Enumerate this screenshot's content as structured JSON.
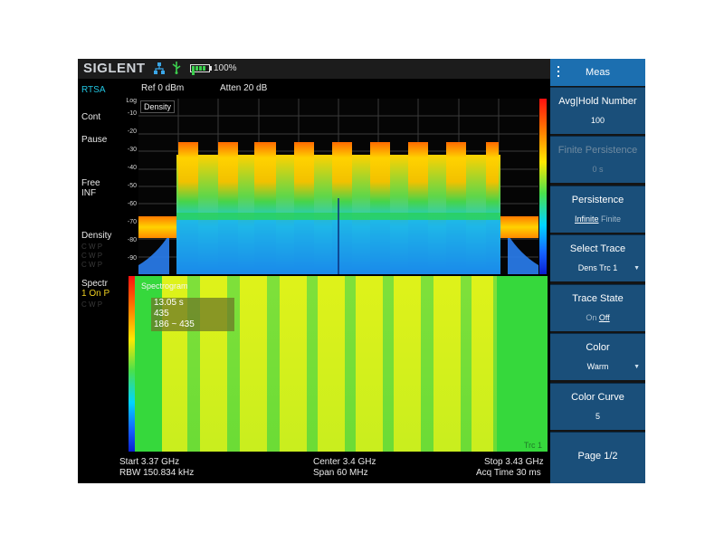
{
  "brand": "SIGLENT",
  "status": {
    "battery": "100%",
    "battery_level": 1.0
  },
  "left": {
    "mode": "RTSA",
    "cont": "Cont",
    "pause": "Pause",
    "free": "Free",
    "inf": "INF",
    "density": "Density",
    "density_sub": [
      "C W P",
      "C W P",
      "C W P"
    ],
    "spectr": "Spectr",
    "spectr_state": "1 On P",
    "spectr_sub": "C W P"
  },
  "header": {
    "ref": "Ref  0 dBm",
    "atten": "Atten  20 dB"
  },
  "yaxis": {
    "scale": "Log",
    "ticks": [
      "-10",
      "-20",
      "-30",
      "-40",
      "-50",
      "-60",
      "-70",
      "-80",
      "-90"
    ]
  },
  "density_plot": {
    "label": "Density"
  },
  "spectrogram": {
    "label": "Spectrogram",
    "readout": [
      "13.05 s",
      "435",
      "186 ~ 435"
    ],
    "trace": "Trc 1"
  },
  "footer": {
    "start": "Start  3.37 GHz",
    "rbw": "RBW  150.834 kHz",
    "center": "Center  3.4 GHz",
    "span": "Span  60 MHz",
    "stop": "Stop  3.43 GHz",
    "acq": "Acq Time  30 ms"
  },
  "panel": {
    "title": "Meas",
    "buttons": [
      {
        "title": "Avg|Hold Number",
        "value": "100"
      },
      {
        "title": "Finite Persistence",
        "value": "0 s"
      },
      {
        "title": "Persistence",
        "opt1": "Infinite",
        "opt2": "Finite"
      },
      {
        "title": "Select Trace",
        "value": "Dens Trc 1"
      },
      {
        "title": "Trace State",
        "opt1": "On",
        "opt2": "Off"
      },
      {
        "title": "Color",
        "value": "Warm"
      },
      {
        "title": "Color Curve",
        "value": "5"
      },
      {
        "title": "Page 1/2"
      }
    ]
  },
  "colors": {
    "panel_button": "#1a4f7a",
    "panel_header": "#1c6fb0",
    "accent_cyan": "#21c4e0",
    "accent_yellow": "#f0d020"
  }
}
